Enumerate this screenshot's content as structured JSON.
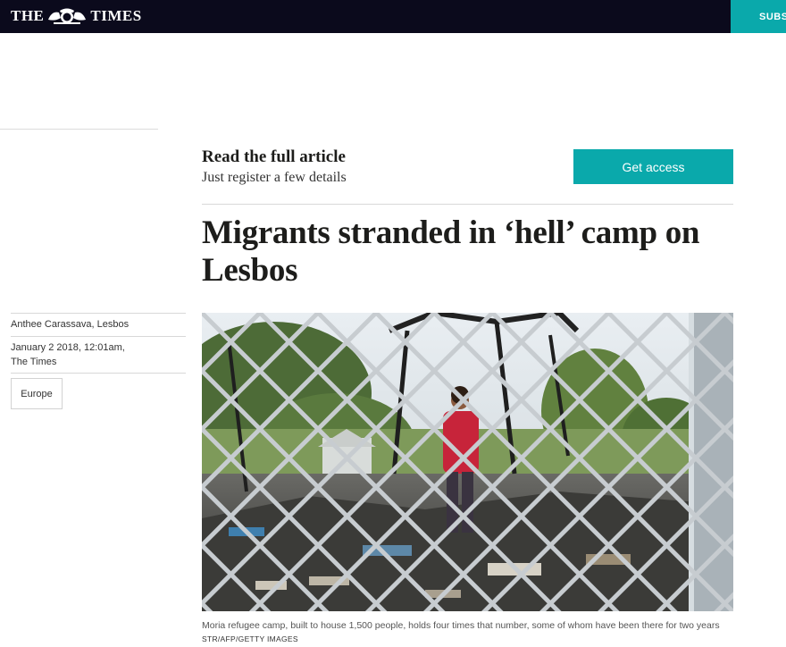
{
  "header": {
    "masthead_left": "THE",
    "masthead_right": "TIMES",
    "crest_icon": "royal-crest-icon",
    "subscribe_label": "SUBS",
    "bar_color": "#0b0a1c",
    "accent_color": "#0aa9ab"
  },
  "paywall": {
    "title": "Read the full article",
    "subtitle": "Just register a few details",
    "button_label": "Get access"
  },
  "article": {
    "headline": "Migrants stranded in ‘hell’ camp on Lesbos",
    "byline": "Anthee Carassava, Lesbos",
    "date": "January 2 2018, 12:01am,",
    "publication": "The Times",
    "tag": "Europe",
    "image_caption": "Moria refugee camp, built to house 1,500 people, holds four times that number, some of whom have been there for two years",
    "image_credit": "STR/AFP/GETTY IMAGES"
  }
}
